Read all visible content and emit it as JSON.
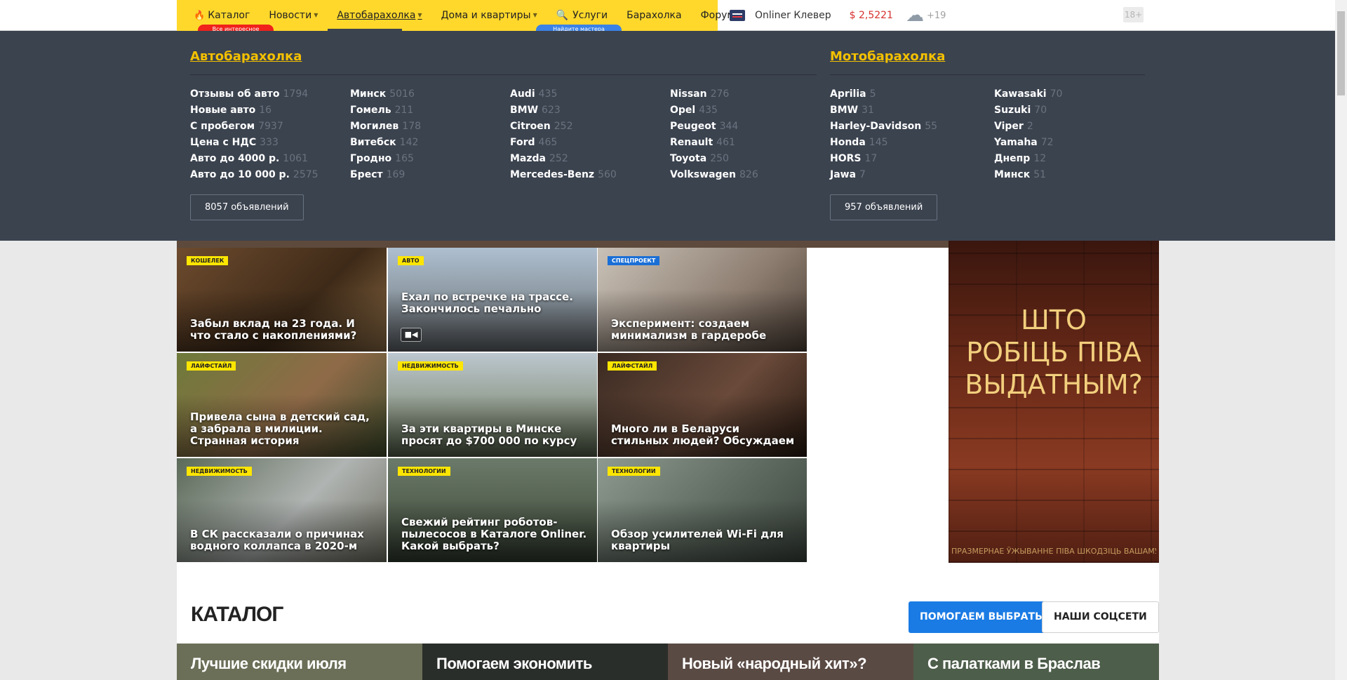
{
  "nav": {
    "catalog": "Каталог",
    "news": "Новости",
    "auto": "Автобарахолка",
    "realty": "Дома и квартиры",
    "services": "Услуги",
    "flea": "Барахолка",
    "forum": "Форум",
    "badge_red": "Все интересное",
    "badge_blue": "Найдите мастера"
  },
  "right_nav": {
    "clever": "Onliner Клевер",
    "rate": "$ 2,5221",
    "temp": "+19",
    "age": "18+"
  },
  "dropdown": {
    "auto_title": "Автобарахолка",
    "moto_title": "Мотобарахолка",
    "auto_cols": [
      [
        [
          "Отзывы об авто",
          "1794"
        ],
        [
          "Новые авто",
          "16"
        ],
        [
          "С пробегом",
          "7937"
        ],
        [
          "Цена с НДС",
          "333"
        ],
        [
          "Авто до 4000 р.",
          "1061"
        ],
        [
          "Авто до 10 000 р.",
          "2575"
        ]
      ],
      [
        [
          "Минск",
          "5016"
        ],
        [
          "Гомель",
          "211"
        ],
        [
          "Могилев",
          "178"
        ],
        [
          "Витебск",
          "142"
        ],
        [
          "Гродно",
          "165"
        ],
        [
          "Брест",
          "169"
        ]
      ],
      [
        [
          "Audi",
          "435"
        ],
        [
          "BMW",
          "623"
        ],
        [
          "Citroen",
          "252"
        ],
        [
          "Ford",
          "465"
        ],
        [
          "Mazda",
          "252"
        ],
        [
          "Mercedes-Benz",
          "560"
        ]
      ],
      [
        [
          "Nissan",
          "276"
        ],
        [
          "Opel",
          "435"
        ],
        [
          "Peugeot",
          "344"
        ],
        [
          "Renault",
          "461"
        ],
        [
          "Toyota",
          "250"
        ],
        [
          "Volkswagen",
          "826"
        ]
      ]
    ],
    "moto_cols": [
      [
        [
          "Aprilia",
          "5"
        ],
        [
          "BMW",
          "31"
        ],
        [
          "Harley-Davidson",
          "55"
        ],
        [
          "Honda",
          "145"
        ],
        [
          "HORS",
          "17"
        ],
        [
          "Jawa",
          "7"
        ]
      ],
      [
        [
          "Kawasaki",
          "70"
        ],
        [
          "Suzuki",
          "70"
        ],
        [
          "Viper",
          "2"
        ],
        [
          "Yamaha",
          "72"
        ],
        [
          "Днепр",
          "12"
        ],
        [
          "Минск",
          "51"
        ]
      ]
    ],
    "auto_count": "8057 объявлений",
    "moto_count": "957 объявлений"
  },
  "tiles": [
    {
      "tag": "Кошелек",
      "title": "Забыл вклад на 23 года. И что стало с накоплениями?"
    },
    {
      "tag": "Авто",
      "title": "Ехал по встречке на трассе. Закончилось печально"
    },
    {
      "tag": "Спецпроект",
      "title": "Эксперимент: создаем минимализм в гардеробе"
    },
    {
      "tag": "Лайфстайл",
      "title": "Привела сына в детский сад, а забрала в милиции. Странная история"
    },
    {
      "tag": "Недвижимость",
      "title": "За эти квартиры в Минске просят до $700 000 по курсу"
    },
    {
      "tag": "Лайфстайл",
      "title": "Много ли в Беларуси стильных людей? Обсуждаем"
    },
    {
      "tag": "Недвижимость",
      "title": "В СК рассказали о причинах водного коллапса в 2020-м"
    },
    {
      "tag": "Технологии",
      "title": "Свежий рейтинг роботов-пылесосов в Каталоге Onliner. Какой выбрать?"
    },
    {
      "tag": "Технологии",
      "title": "Обзор усилителей Wi-Fi для квартиры"
    }
  ],
  "ad": {
    "line1": "ШТО",
    "line2": "РОБІЦЬ ПІВА",
    "line3": "ВЫДАТНЫМ?",
    "fine": "ПРАЗМЕРНАЕ ЎЖЫВАННЕ ПІВА ШКОДЗІЦЬ ВАШАМУ ЗДАРОЎЮ"
  },
  "catalog": {
    "title": "КАТАЛОГ",
    "btn_help": "ПОМОГАЕМ ВЫБРАТЬ",
    "btn_social": "НАШИ СОЦСЕТИ",
    "cards": [
      "Лучшие скидки июля",
      "Помогаем экономить",
      "Новый «народный хит»?",
      "С палатками в Браслав"
    ]
  },
  "colors": {
    "nav_yellow": "#ffd82b",
    "dropdown_bg": "#3b434f",
    "accent_gold": "#f3c000",
    "rate_red": "#d6312f",
    "button_blue": "#1a7be4"
  },
  "icons": [
    "fire-icon",
    "chevron-down-icon",
    "search-icon",
    "clever-icon",
    "weather-icon",
    "video-icon"
  ]
}
